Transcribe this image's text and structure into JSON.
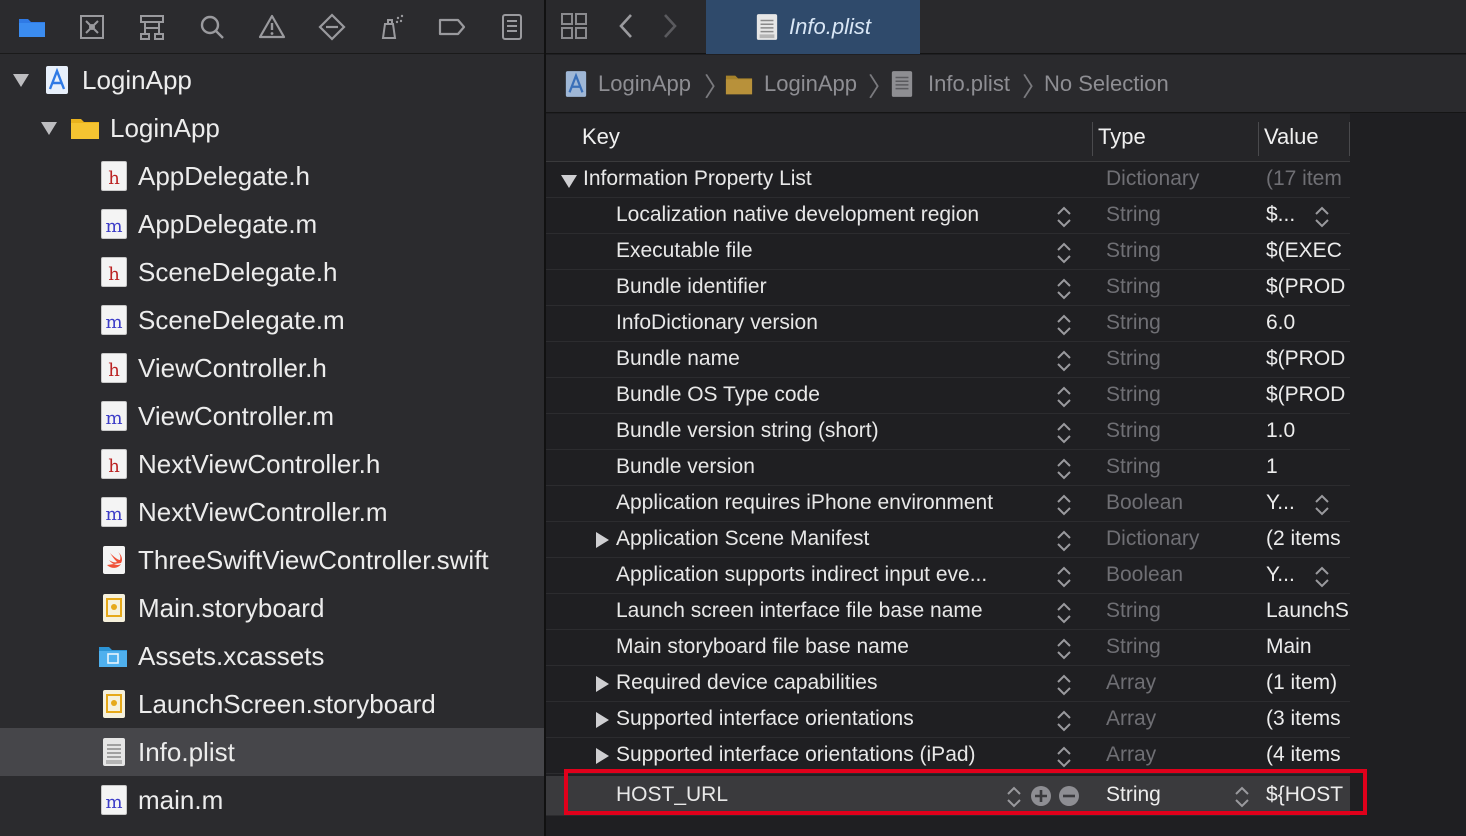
{
  "navigator": {
    "toolbar_icons": [
      "folder-icon",
      "source-control-icon",
      "hierarchy-icon",
      "search-icon",
      "warning-icon",
      "test-diamond-icon",
      "debug-spray-icon",
      "breakpoint-tag-icon",
      "report-list-icon"
    ],
    "project": {
      "name": "LoginApp",
      "icon": "xcode-project-icon"
    },
    "group": {
      "name": "LoginApp",
      "icon": "yellow-folder-icon"
    },
    "files": [
      {
        "name": "AppDelegate.h",
        "kind": "h"
      },
      {
        "name": "AppDelegate.m",
        "kind": "m"
      },
      {
        "name": "SceneDelegate.h",
        "kind": "h"
      },
      {
        "name": "SceneDelegate.m",
        "kind": "m"
      },
      {
        "name": "ViewController.h",
        "kind": "h"
      },
      {
        "name": "ViewController.m",
        "kind": "m"
      },
      {
        "name": "NextViewController.h",
        "kind": "h"
      },
      {
        "name": "NextViewController.m",
        "kind": "m"
      },
      {
        "name": "ThreeSwiftViewController.swift",
        "kind": "swift"
      },
      {
        "name": "Main.storyboard",
        "kind": "storyboard"
      },
      {
        "name": "Assets.xcassets",
        "kind": "assets"
      },
      {
        "name": "LaunchScreen.storyboard",
        "kind": "storyboard"
      },
      {
        "name": "Info.plist",
        "kind": "plist",
        "selected": true
      },
      {
        "name": "main.m",
        "kind": "m"
      }
    ]
  },
  "editor": {
    "tab": {
      "label": "Info.plist"
    },
    "jumpbar": {
      "crumbs": [
        "LoginApp",
        "LoginApp",
        "Info.plist",
        "No Selection"
      ]
    },
    "plist": {
      "columns": {
        "key": "Key",
        "type": "Type",
        "value": "Value"
      },
      "root": {
        "key": "Information Property List",
        "type": "Dictionary",
        "value": "(17 item"
      },
      "rows": [
        {
          "key": "Localization native development region",
          "type": "String",
          "value": "$...",
          "value_stepper": true
        },
        {
          "key": "Executable file",
          "type": "String",
          "value": "$(EXEC"
        },
        {
          "key": "Bundle identifier",
          "type": "String",
          "value": "$(PROD"
        },
        {
          "key": "InfoDictionary version",
          "type": "String",
          "value": "6.0"
        },
        {
          "key": "Bundle name",
          "type": "String",
          "value": "$(PROD"
        },
        {
          "key": "Bundle OS Type code",
          "type": "String",
          "value": "$(PROD"
        },
        {
          "key": "Bundle version string (short)",
          "type": "String",
          "value": "1.0"
        },
        {
          "key": "Bundle version",
          "type": "String",
          "value": "1"
        },
        {
          "key": "Application requires iPhone environment",
          "type": "Boolean",
          "value": "Y...",
          "value_stepper": true
        },
        {
          "key": "Application Scene Manifest",
          "type": "Dictionary",
          "value": "(2 items",
          "expandable": true
        },
        {
          "key": "Application supports indirect input eve...",
          "type": "Boolean",
          "value": "Y...",
          "value_stepper": true
        },
        {
          "key": "Launch screen interface file base name",
          "type": "String",
          "value": "LaunchS"
        },
        {
          "key": "Main storyboard file base name",
          "type": "String",
          "value": "Main"
        },
        {
          "key": "Required device capabilities",
          "type": "Array",
          "value": "(1 item)",
          "expandable": true
        },
        {
          "key": "Supported interface orientations",
          "type": "Array",
          "value": "(3 items",
          "expandable": true
        },
        {
          "key": "Supported interface orientations (iPad)",
          "type": "Array",
          "value": "(4 items",
          "expandable": true
        }
      ],
      "new_row": {
        "key": "HOST_URL",
        "type": "String",
        "value": "${HOST"
      }
    }
  },
  "colors": {
    "highlight": "#e0001b",
    "selection": "#46464a",
    "tab_active": "#2f4a6b"
  }
}
